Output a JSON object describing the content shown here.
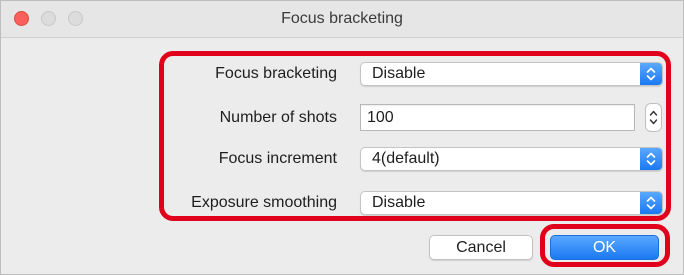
{
  "window": {
    "title": "Focus bracketing"
  },
  "form": {
    "focus_bracketing": {
      "label": "Focus bracketing",
      "value": "Disable"
    },
    "number_of_shots": {
      "label": "Number of shots",
      "value": "100"
    },
    "focus_increment": {
      "label": "Focus increment",
      "value": "4(default)"
    },
    "exposure_smoothing": {
      "label": "Exposure smoothing",
      "value": "Disable"
    }
  },
  "buttons": {
    "cancel": "Cancel",
    "ok": "OK"
  },
  "colors": {
    "accent": "#1a79f2",
    "highlight": "#e0001b",
    "close": "#fc605c"
  },
  "icons": {
    "popup": "up-down-chevron-icon",
    "stepper": "stepper-arrows-icon"
  }
}
